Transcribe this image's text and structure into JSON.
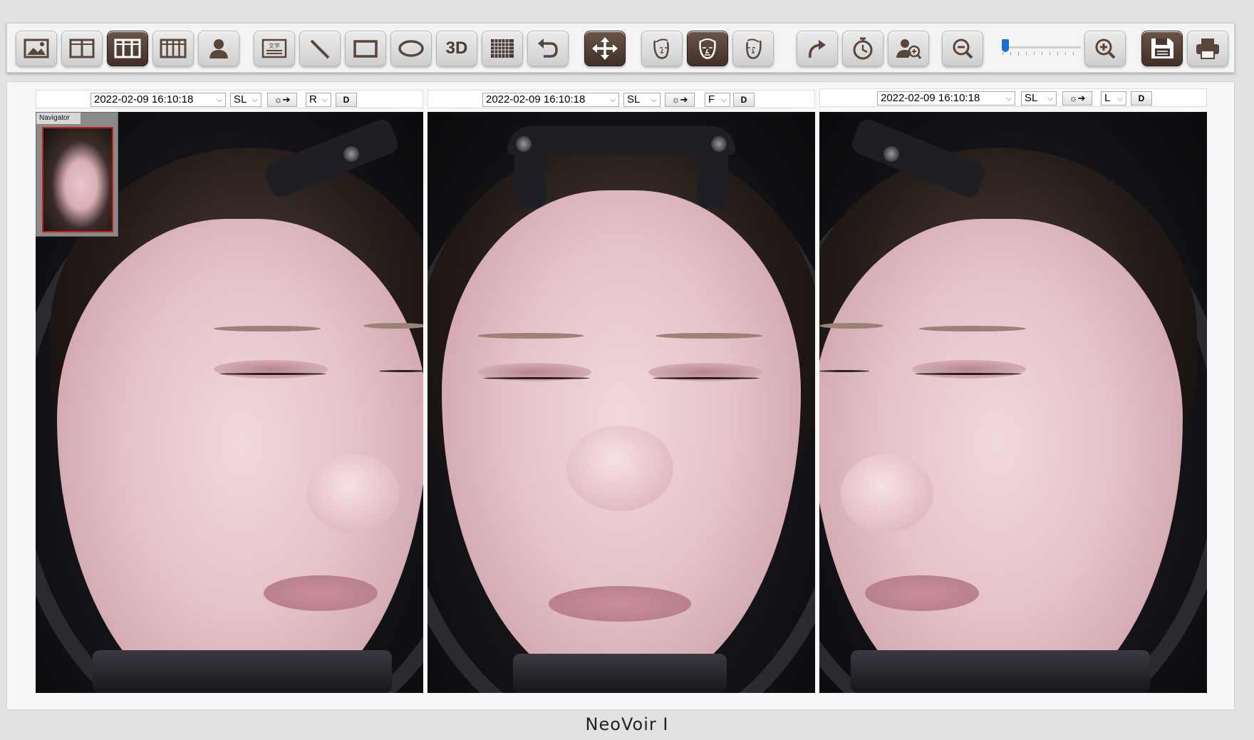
{
  "toolbar": {
    "slider_level_percent": 4,
    "buttons": [
      {
        "name": "single-image-button",
        "icon": "picture-icon"
      },
      {
        "name": "two-pane-button",
        "icon": "two-pane-icon"
      },
      {
        "name": "three-pane-button",
        "icon": "three-pane-icon"
      },
      {
        "name": "four-pane-button",
        "icon": "four-pane-icon"
      },
      {
        "name": "patient-button",
        "icon": "person-icon"
      },
      {
        "name": "text-button",
        "icon": "text-icon",
        "glyph": "文字"
      },
      {
        "name": "line-tool-button",
        "icon": "line-icon"
      },
      {
        "name": "rectangle-tool-button",
        "icon": "rectangle-icon"
      },
      {
        "name": "ellipse-tool-button",
        "icon": "ellipse-icon"
      },
      {
        "name": "3d-button",
        "icon": "3d-icon",
        "label": "3D"
      },
      {
        "name": "grid-button",
        "icon": "grid-icon"
      },
      {
        "name": "undo-button",
        "icon": "undo-icon"
      },
      {
        "name": "move-button",
        "icon": "move-icon"
      },
      {
        "name": "right-face-button",
        "icon": "face-right-icon"
      },
      {
        "name": "front-face-button",
        "icon": "face-front-icon"
      },
      {
        "name": "left-face-button",
        "icon": "face-left-icon"
      },
      {
        "name": "redo-button",
        "icon": "redo-icon"
      },
      {
        "name": "timer-button",
        "icon": "timer-icon"
      },
      {
        "name": "user-zoom-button",
        "icon": "user-search-icon"
      },
      {
        "name": "zoom-out-button",
        "icon": "zoom-out-icon"
      },
      {
        "name": "zoom-in-button",
        "icon": "zoom-in-icon"
      },
      {
        "name": "save-button",
        "icon": "save-icon"
      },
      {
        "name": "print-button",
        "icon": "print-icon"
      }
    ],
    "accent_color": "#4a3930"
  },
  "panes": [
    {
      "date": "2022-02-09 16:10:18",
      "mode": "SL",
      "view": "R",
      "d_label": "D",
      "light_glyph": "☼➔"
    },
    {
      "date": "2022-02-09 16:10:18",
      "mode": "SL",
      "view": "F",
      "d_label": "D",
      "light_glyph": "☼➔"
    },
    {
      "date": "2022-02-09 16:10:18",
      "mode": "SL",
      "view": "L",
      "d_label": "D",
      "light_glyph": "☼➔"
    }
  ],
  "navigator": {
    "title": "Navigator"
  },
  "footer": {
    "brand": "NeoVoir I"
  }
}
